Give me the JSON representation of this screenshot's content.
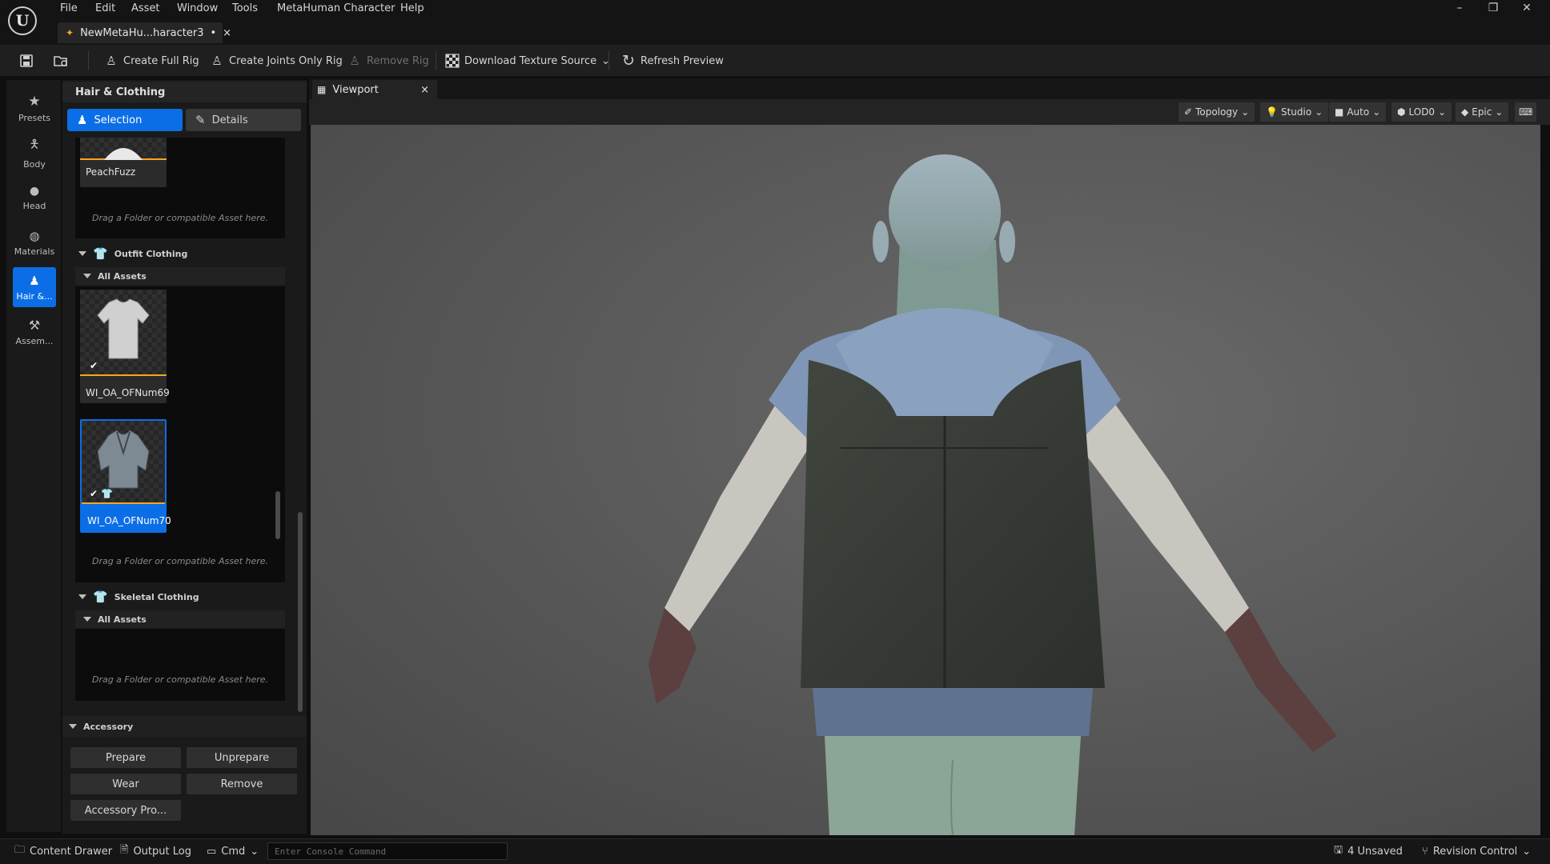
{
  "menu": [
    "File",
    "Edit",
    "Asset",
    "Window",
    "Tools",
    "MetaHuman Character",
    "Help"
  ],
  "document_tab": {
    "title": "NewMetaHu...haracter3",
    "dirty": "•",
    "close": "×"
  },
  "window_controls": {
    "minimize": "–",
    "maximize": "❐",
    "close": "✕"
  },
  "toolbar": {
    "create_full_rig": "Create Full Rig",
    "create_joints_only_rig": "Create Joints Only Rig",
    "remove_rig": "Remove Rig",
    "download_texture_source": "Download Texture Source",
    "refresh_preview": "Refresh Preview"
  },
  "sidebar": {
    "items": [
      {
        "label": "Presets",
        "icon": "star-icon"
      },
      {
        "label": "Body",
        "icon": "body-icon"
      },
      {
        "label": "Head",
        "icon": "head-icon"
      },
      {
        "label": "Materials",
        "icon": "materials-icon"
      },
      {
        "label": "Hair &...",
        "icon": "hair-clothing-icon",
        "active": true
      },
      {
        "label": "Assem...",
        "icon": "assembly-icon"
      }
    ]
  },
  "panel": {
    "title": "Hair & Clothing",
    "tab_selection": "Selection",
    "tab_details": "Details",
    "groom": {
      "asset_label": "PeachFuzz",
      "drop_hint": "Drag a Folder or compatible Asset here."
    },
    "outfit": {
      "header": "Outfit Clothing",
      "subheader": "All Assets",
      "assets": [
        {
          "label": "WI_OA_OFNum69"
        },
        {
          "label": "WI_OA_OFNum70",
          "selected": true
        }
      ],
      "drop_hint": "Drag a Folder or compatible Asset here."
    },
    "skeletal": {
      "header": "Skeletal Clothing",
      "subheader": "All Assets",
      "drop_hint": "Drag a Folder or compatible Asset here."
    },
    "accessory": {
      "header": "Accessory",
      "prepare": "Prepare",
      "unprepare": "Unprepare",
      "wear": "Wear",
      "remove": "Remove",
      "properties": "Accessory Pro..."
    }
  },
  "viewport": {
    "tab": "Viewport",
    "tab_close": "×",
    "topology": "Topology",
    "lighting": "Studio",
    "camera": "Auto",
    "lod": "LOD0",
    "quality": "Epic"
  },
  "statusbar": {
    "content_drawer": "Content Drawer",
    "output_log": "Output Log",
    "cmd": "Cmd",
    "console_placeholder": "Enter Console Command",
    "unsaved": "4 Unsaved",
    "revision_control": "Revision Control"
  },
  "colors": {
    "accent": "#0c6ee6",
    "selection_outline": "#f5a623",
    "background": "#0f0f0f"
  }
}
